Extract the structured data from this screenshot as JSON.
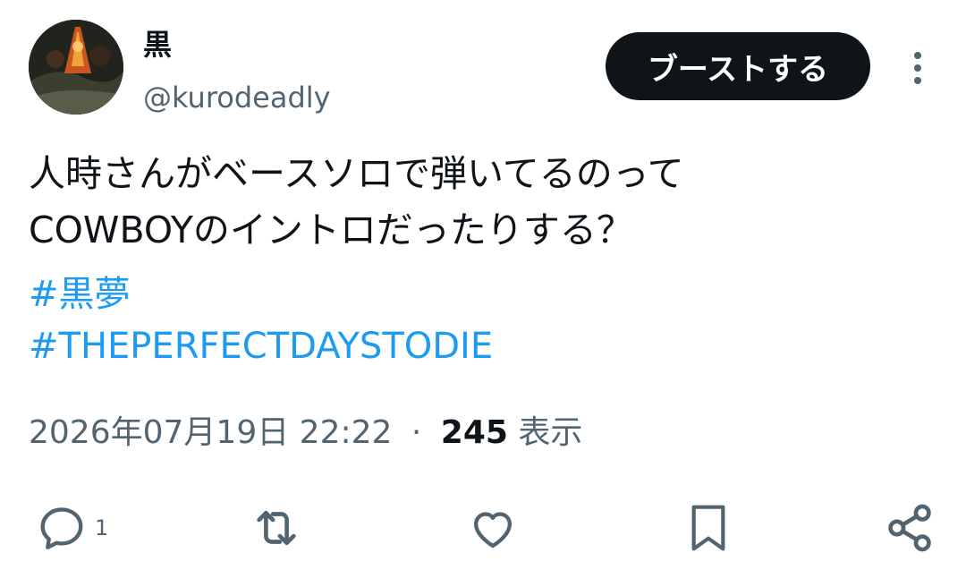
{
  "author": {
    "display_name": "黒",
    "handle": "@kurodeadly"
  },
  "header": {
    "boost_label": "ブーストする",
    "more_icon": "vertical-dots-icon"
  },
  "post": {
    "text_lines": [
      "人時さんがベースソロで弾いてるのって",
      "COWBOYのイントロだったりする？"
    ],
    "hashtags": [
      "#黒夢",
      "#THEPERFECTDAYSTODIE"
    ],
    "timestamp": "2026年07月19日 22:22",
    "separator": "·",
    "views_count": "245",
    "views_label": "表示"
  },
  "actions": {
    "reply_icon": "reply-bubble-icon",
    "reply_count": "1",
    "repost_icon": "repost-icon",
    "like_icon": "heart-icon",
    "bookmark_icon": "bookmark-icon",
    "share_icon": "share-icon"
  },
  "colors": {
    "text": "#0f1419",
    "secondary": "#536471",
    "link": "#1d9bf0",
    "button_bg": "#0f1419"
  }
}
